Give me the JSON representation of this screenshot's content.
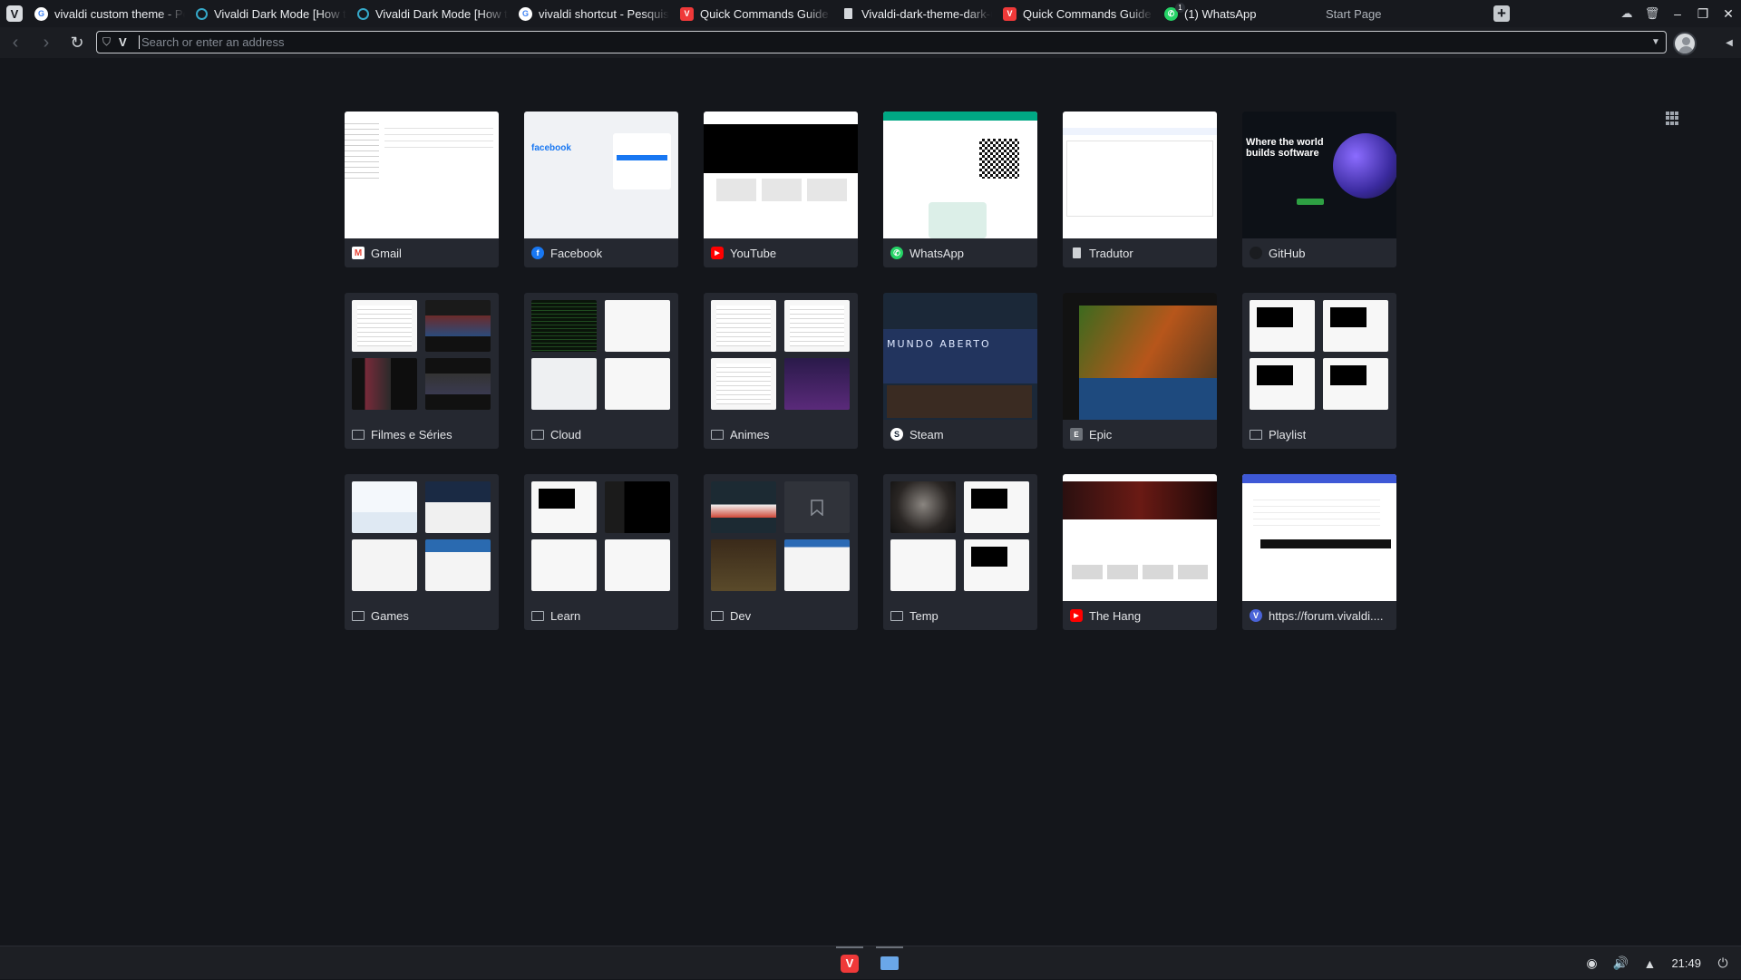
{
  "tabs": [
    {
      "title": "vivaldi custom theme - Pes",
      "favicon": "google-icon"
    },
    {
      "title": "Vivaldi Dark Mode [How to",
      "favicon": "vivaldi-ring-icon"
    },
    {
      "title": "Vivaldi Dark Mode [How to",
      "favicon": "vivaldi-ring-icon"
    },
    {
      "title": "vivaldi shortcut - Pesquisa",
      "favicon": "google-icon"
    },
    {
      "title": "Quick Commands Guide | V",
      "favicon": "vivaldi-red-icon"
    },
    {
      "title": "Vivaldi-dark-theme-dark-u",
      "favicon": "document-icon"
    },
    {
      "title": "Quick Commands Guide | V",
      "favicon": "vivaldi-red-icon"
    },
    {
      "title": "(1) WhatsApp",
      "favicon": "whatsapp-icon",
      "badge": "1"
    }
  ],
  "active_tab": {
    "title": "Start Page",
    "favicon": "grid-icon"
  },
  "address_bar": {
    "placeholder": "Search or enter an address",
    "value": ""
  },
  "speed_dial": [
    {
      "label": "Gmail",
      "icon": "gmail-icon"
    },
    {
      "label": "Facebook",
      "icon": "facebook-icon"
    },
    {
      "label": "YouTube",
      "icon": "youtube-icon"
    },
    {
      "label": "WhatsApp",
      "icon": "whatsapp-icon"
    },
    {
      "label": "Tradutor",
      "icon": "document-icon"
    },
    {
      "label": "GitHub",
      "icon": "github-icon"
    },
    {
      "label": "Filmes e Séries",
      "icon": "folder-icon"
    },
    {
      "label": "Cloud",
      "icon": "folder-icon"
    },
    {
      "label": "Animes",
      "icon": "folder-icon"
    },
    {
      "label": "Steam",
      "icon": "steam-icon"
    },
    {
      "label": "Epic",
      "icon": "epic-icon"
    },
    {
      "label": "Playlist",
      "icon": "folder-icon"
    },
    {
      "label": "Games",
      "icon": "folder-icon"
    },
    {
      "label": "Learn",
      "icon": "folder-icon"
    },
    {
      "label": "Dev",
      "icon": "folder-icon"
    },
    {
      "label": "Temp",
      "icon": "folder-icon"
    },
    {
      "label": "The Hang",
      "icon": "youtube-icon"
    },
    {
      "label": "https://forum.vivaldi....",
      "icon": "vivaldi-icon"
    }
  ],
  "thumb_text": {
    "facebook": "facebook",
    "github": "Where the world builds software",
    "steam": "MUNDO ABERTO"
  },
  "taskbar": {
    "clock": "21:49"
  },
  "colors": {
    "background": "#14161b",
    "tile": "#252830",
    "accent": "#ef3939"
  }
}
